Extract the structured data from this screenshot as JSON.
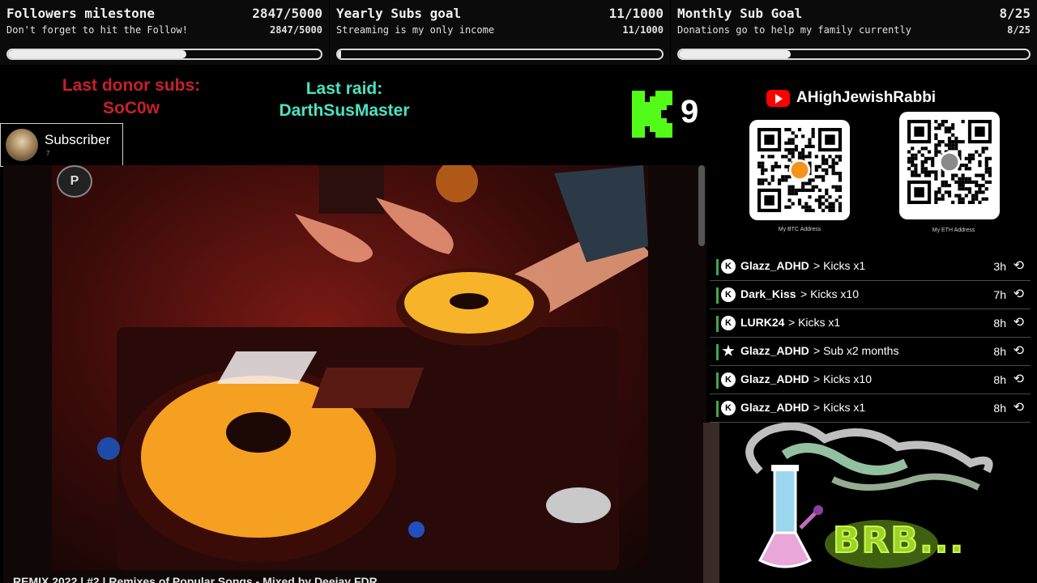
{
  "goals": [
    {
      "title": "Followers milestone",
      "count": "2847/5000",
      "subtitle": "Don't forget to hit the Follow!",
      "progress": 0.569
    },
    {
      "title": "Yearly Subs goal",
      "count": "11/1000",
      "subtitle": "Streaming is my only income",
      "progress": 0.011
    },
    {
      "title": "Monthly Sub Goal",
      "count": "8/25",
      "subtitle": "Donations go to help my family currently",
      "progress": 0.32
    }
  ],
  "donor": {
    "label": "Last donor subs:",
    "name": "SoC0w"
  },
  "raid": {
    "label": "Last raid:",
    "name": "DarthSusMaster"
  },
  "kick": {
    "count": "9",
    "brand_color": "#53fc18"
  },
  "subscriber_popup": {
    "title": "Subscriber",
    "count": "7"
  },
  "video": {
    "badge": "P",
    "caption": "REMIX 2022 | #2 | Remixes of Popular Songs - Mixed by Deejay FDR"
  },
  "youtube": {
    "icon": "youtube-icon",
    "channel": "AHighJewishRabbi"
  },
  "qr": [
    {
      "label": "My BTC Address",
      "coin": "bitcoin-icon",
      "color": "#f7931a"
    },
    {
      "label": "My ETH Address",
      "coin": "ethereum-icon",
      "color": "#8a8a8a"
    }
  ],
  "events": [
    {
      "icon": "kick-icon",
      "user": "Glazz_ADHD",
      "action": "> Kicks x1",
      "time": "3h"
    },
    {
      "icon": "kick-icon",
      "user": "Dark_Kiss",
      "action": "> Kicks x10",
      "time": "7h"
    },
    {
      "icon": "kick-icon",
      "user": "LURK24",
      "action": "> Kicks x1",
      "time": "8h"
    },
    {
      "icon": "star-icon",
      "user": "Glazz_ADHD",
      "action": "> Sub x2 months",
      "time": "8h"
    },
    {
      "icon": "kick-icon",
      "user": "Glazz_ADHD",
      "action": "> Kicks x10",
      "time": "8h"
    },
    {
      "icon": "kick-icon",
      "user": "Glazz_ADHD",
      "action": "> Kicks x1",
      "time": "8h"
    }
  ],
  "brb": {
    "text": "BRB..."
  }
}
